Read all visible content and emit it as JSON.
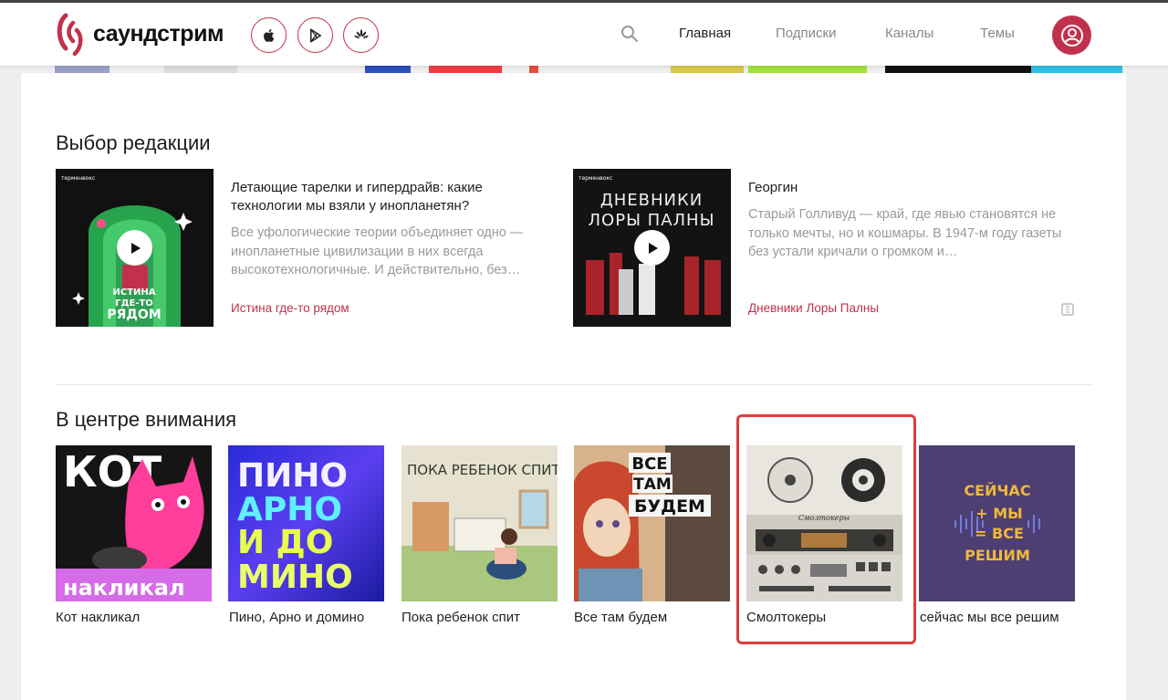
{
  "header": {
    "logo_text": "саундстрим",
    "nav": [
      {
        "label": "Главная",
        "active": true
      },
      {
        "label": "Подписки",
        "active": false
      },
      {
        "label": "Каналы",
        "active": false
      },
      {
        "label": "Темы",
        "active": false
      }
    ],
    "store_icons": [
      "apple-icon",
      "google-play-icon",
      "huawei-icon"
    ],
    "search_icon": "search-icon",
    "avatar_icon": "user-icon"
  },
  "editors_choice": {
    "title": "Выбор редакции",
    "items": [
      {
        "title": "Летающие тарелки и гипердрайв: какие технологии мы взяли у инопланетян?",
        "description": "Все уфологические теории объединяет одно — инопланетные цивилизации в них всегда высокотехнологичные. И действительно, без…",
        "channel": "Истина где-то рядом",
        "cover_text": "ИСТИНА ГДЕ-ТО РЯДОМ",
        "brand": "терменвокс"
      },
      {
        "title": "Георгин",
        "description": "Старый Голливуд — край, где явью становятся не только мечты, но и кошмары. В 1947-м году газеты без устали кричали о громком и…",
        "channel": "Дневники Лоры Палны",
        "cover_text_line1": "ДНЕВНИКИ",
        "cover_text_line2": "ЛОРЫ ПАЛНЫ",
        "brand": "терменвокс"
      }
    ]
  },
  "spotlight": {
    "title": "В центре внимания",
    "items": [
      {
        "label": "Кот накликал",
        "cover_line1": "КОТ",
        "cover_line2": "накликал"
      },
      {
        "label": "Пино, Арно и домино",
        "cover_line1": "ПИНО",
        "cover_line2": "АРНО",
        "cover_line3": "И ДО",
        "cover_line4": "МИНО"
      },
      {
        "label": "Пока ребенок спит",
        "cover_line1": "ПОКА РЕБЕНОК СПИТ"
      },
      {
        "label": "Все там будем",
        "cover_line1": "ВСЕ",
        "cover_line2": "ТАМ",
        "cover_line3": "БУДЕМ"
      },
      {
        "label": "Смолтокеры",
        "cover_line1": "Смолтокеры"
      },
      {
        "label": "сейчас мы все решим",
        "cover_line1": "СЕЙЧАС",
        "cover_line2": "+ МЫ",
        "cover_line3": "= ВСЕ",
        "cover_line4": "РЕШИМ"
      }
    ]
  },
  "colors": {
    "accent": "#c2314b",
    "highlight": "#e03c3c"
  }
}
